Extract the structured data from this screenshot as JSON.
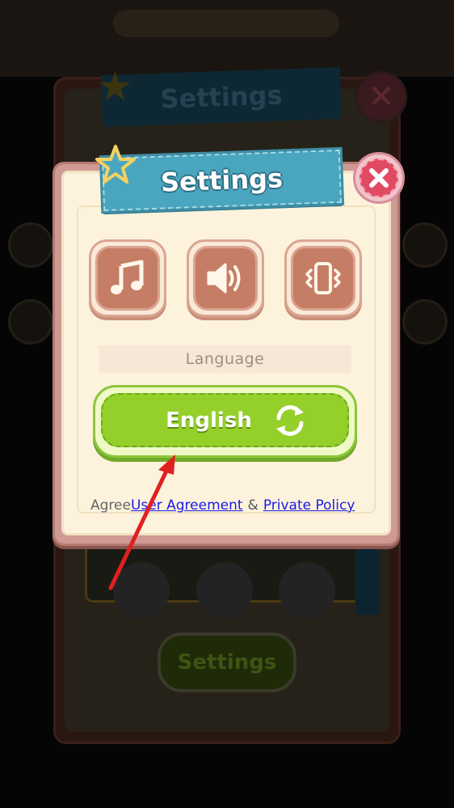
{
  "background": {
    "panel_title": "Settings",
    "bottom_button_label": "Settings"
  },
  "dialog": {
    "title": "Settings",
    "language_label": "Language",
    "language_value": "English",
    "toggles": [
      {
        "name": "music",
        "icon": "music-note-icon"
      },
      {
        "name": "sound",
        "icon": "speaker-icon"
      },
      {
        "name": "vibration",
        "icon": "vibration-icon"
      }
    ],
    "close_icon": "close-icon"
  },
  "footer": {
    "agree_text": "Agree",
    "user_agreement": "User Agreement",
    "ampersand": "&",
    "private_policy": "Private Policy"
  },
  "colors": {
    "ribbon": "#4aa6bf",
    "close": "#e04b63",
    "toggle": "#c57e65",
    "language_button": "#95d02a",
    "link": "#1a1ae6",
    "annotation_arrow": "#e02020"
  }
}
